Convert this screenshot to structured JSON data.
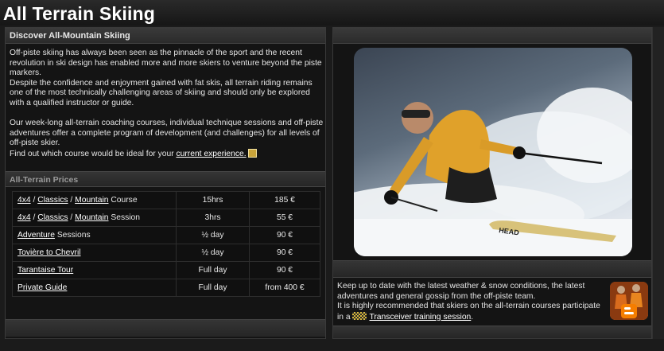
{
  "page": {
    "title": "All Terrain Skiing"
  },
  "intro": {
    "heading": "Discover All-Mountain Skiing",
    "p1": "Off-piste skiing has always been seen as the pinnacle of the sport and the recent revolution in ski design has enabled more and more skiers to venture beyond the piste markers.",
    "p2": "Despite the confidence and enjoyment gained with fat skis, all terrain riding remains one of the most technically challenging areas of skiing and should only be explored with a qualified instructor or guide.",
    "p3": "Our week-long all-terrain coaching courses, individual technique sessions and off-piste adventures offer a complete program of development (and challenges) for all levels of off-piste skier.",
    "p4_prefix": "Find out which course would be ideal for your ",
    "p4_link": "current experience."
  },
  "prices": {
    "heading": "All-Terrain Prices",
    "rows": [
      {
        "links": [
          "4x4",
          "Classics",
          "Mountain"
        ],
        "suffix": " Course",
        "duration": "15hrs",
        "price": "185 €"
      },
      {
        "links": [
          "4x4",
          "Classics",
          "Mountain"
        ],
        "suffix": " Session",
        "duration": "3hrs",
        "price": "55 €"
      },
      {
        "link": "Adventure",
        "suffix": " Sessions",
        "duration": "½ day",
        "price": "90 €"
      },
      {
        "link": "Tovière to Chevril",
        "suffix": "",
        "duration": "½ day",
        "price": "90 €"
      },
      {
        "link": "Tarantaise Tour",
        "suffix": "",
        "duration": "Full day",
        "price": "90 €"
      },
      {
        "link": "Private Guide",
        "suffix": "",
        "duration": "Full day",
        "price": "from 400 €"
      }
    ]
  },
  "news": {
    "line1": "Keep up to date with the latest weather & snow conditions, the latest adventures and general gossip from the off-piste team.",
    "line2_prefix": "It is highly recommended that skiers on the all-terrain courses participate in a ",
    "line2_link": "Transceiver training session",
    "line2_suffix": "."
  },
  "photo": {
    "ski_brand": "HEAD"
  },
  "icons": {
    "experience_link_icon": "star-badge-icon",
    "transceiver_icon": "checkered-flag-icon",
    "blog_icon": "blogger-icon"
  },
  "colors": {
    "background": "#1b1b1b",
    "panel": "#141414",
    "text": "#e6e6e6",
    "heading_muted": "#9a9a9a",
    "jacket": "#e0a12a"
  }
}
